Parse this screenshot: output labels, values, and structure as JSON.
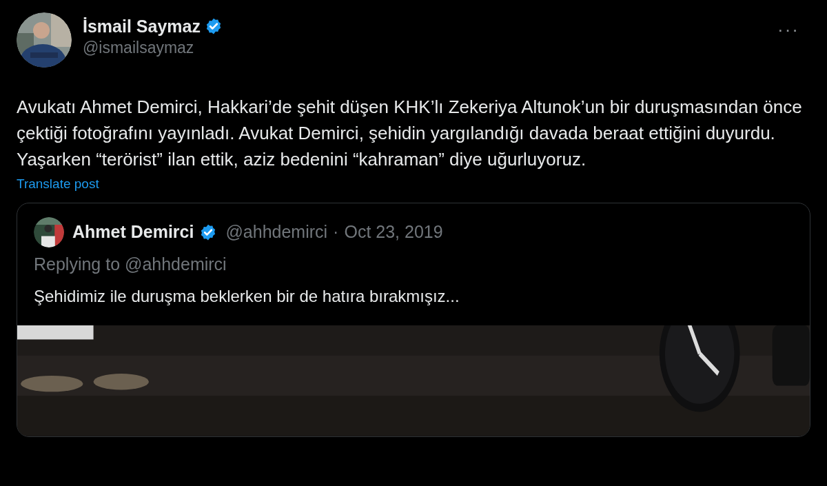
{
  "author": {
    "name": "İsmail Saymaz",
    "verified": true,
    "handle": "@ismailsaymaz"
  },
  "more_menu": "···",
  "body": "Avukatı Ahmet Demirci, Hakkari’de şehit düşen KHK’lı Zekeriya Altunok’un bir duruşmasından önce çektiği fotoğrafını yayınladı. Avukat Demirci, şehidin yargılandığı davada beraat ettiğini duyurdu. Yaşarken “terörist” ilan ettik, aziz bedenini “kahraman” diye uğurluyoruz.",
  "translate_link": "Translate post",
  "quoted": {
    "name": "Ahmet Demirci",
    "verified": true,
    "handle": "@ahhdemirci",
    "separator": "·",
    "date": "Oct 23, 2019",
    "replying_to": "Replying to @ahhdemirci",
    "text": "Şehidimiz ile duruşma beklerken bir de hatıra bırakmışız..."
  }
}
